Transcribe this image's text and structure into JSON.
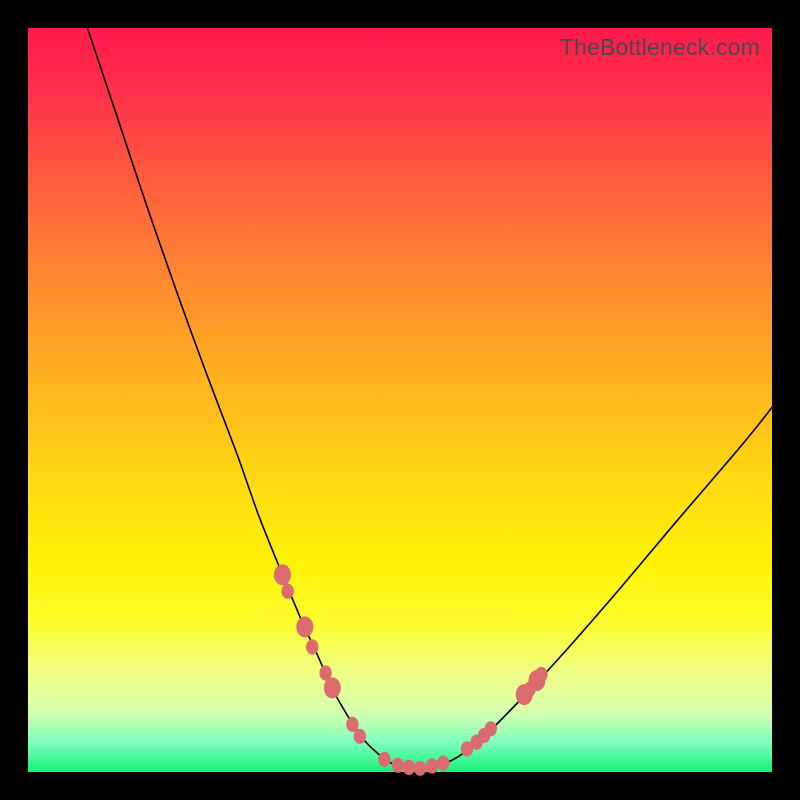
{
  "watermark": "TheBottleneck.com",
  "colors": {
    "frame_border": "#000000",
    "curve": "#000000",
    "marker": "#db6b6e"
  },
  "chart_data": {
    "type": "line",
    "title": "",
    "xlabel": "",
    "ylabel": "",
    "xlim": [
      0,
      100
    ],
    "ylim": [
      0,
      100
    ],
    "note": "Axes are unlabeled in the image; values below are pixel-proportional positions (0–100) estimated from geometry.",
    "series": [
      {
        "name": "bottleneck-curve",
        "x": [
          8,
          12,
          16,
          20,
          24,
          28,
          31,
          34,
          36.5,
          39,
          41,
          43,
          45,
          47,
          48.8,
          50.5,
          53,
          57,
          61,
          66,
          72,
          79,
          87,
          96,
          100
        ],
        "values": [
          100,
          88,
          76,
          64.5,
          53.5,
          43,
          34.5,
          27,
          21,
          15.5,
          11,
          7.5,
          4.5,
          2.5,
          1.2,
          0.6,
          0.5,
          1.6,
          4.5,
          9.5,
          16,
          24,
          33.5,
          44,
          49
        ]
      }
    ],
    "markers": [
      {
        "x": 34.2,
        "y": 26.5,
        "size": "big"
      },
      {
        "x": 34.9,
        "y": 24.3
      },
      {
        "x": 37.2,
        "y": 19.5,
        "size": "big"
      },
      {
        "x": 38.2,
        "y": 16.8
      },
      {
        "x": 40.0,
        "y": 13.3
      },
      {
        "x": 40.9,
        "y": 11.3,
        "size": "big"
      },
      {
        "x": 43.6,
        "y": 6.4
      },
      {
        "x": 44.6,
        "y": 4.8
      },
      {
        "x": 47.9,
        "y": 1.7
      },
      {
        "x": 49.7,
        "y": 0.9
      },
      {
        "x": 51.2,
        "y": 0.6
      },
      {
        "x": 52.7,
        "y": 0.5
      },
      {
        "x": 54.3,
        "y": 0.8
      },
      {
        "x": 55.8,
        "y": 1.2
      },
      {
        "x": 59.0,
        "y": 3.1
      },
      {
        "x": 60.3,
        "y": 4.0
      },
      {
        "x": 61.3,
        "y": 4.9
      },
      {
        "x": 62.2,
        "y": 5.8
      },
      {
        "x": 66.7,
        "y": 10.4,
        "size": "big"
      },
      {
        "x": 67.4,
        "y": 11.1
      },
      {
        "x": 68.4,
        "y": 12.3,
        "size": "big"
      },
      {
        "x": 69.0,
        "y": 13.1
      }
    ]
  }
}
